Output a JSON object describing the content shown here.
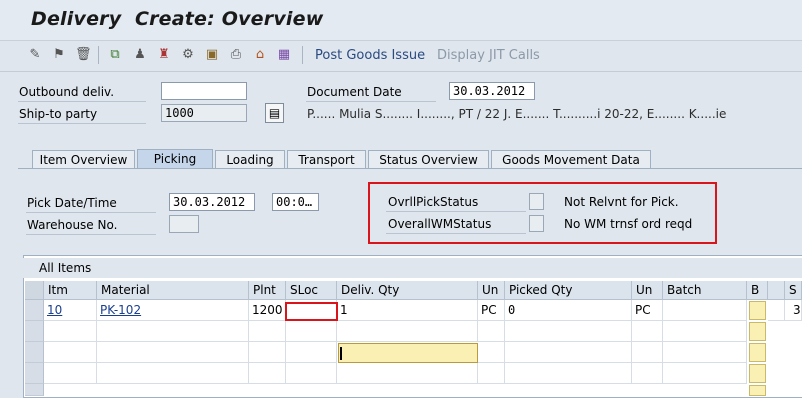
{
  "title": "Delivery  Create: Overview",
  "toolbar": {
    "icons": [
      "edit-icon",
      "flag-icon",
      "delete-icon",
      "save-local-icon",
      "person-icon",
      "partner-icon",
      "tools-icon",
      "package-icon",
      "print-icon",
      "home-icon",
      "grid-icon"
    ],
    "post_goods_issue": "Post Goods Issue",
    "display_jit_calls": "Display JIT Calls"
  },
  "header": {
    "outbound_deliv_label": "Outbound deliv.",
    "outbound_deliv_value": "",
    "ship_to_label": "Ship-to party",
    "ship_to_value": "1000",
    "document_date_label": "Document Date",
    "document_date_value": "30.03.2012",
    "address_text": "P...... Mulia S........ I........, PT / 22 J. E....... T..........i 20-22, E........ K.....ie"
  },
  "tabs": [
    "Item Overview",
    "Picking",
    "Loading",
    "Transport",
    "Status Overview",
    "Goods Movement Data"
  ],
  "active_tab": "Picking",
  "picking": {
    "pick_date_label": "Pick Date/Time",
    "pick_date_value": "30.03.2012",
    "pick_time_value": "00:0…",
    "warehouse_label": "Warehouse No.",
    "warehouse_value": "",
    "ovrll_pick_label": "OvrllPickStatus",
    "ovrll_pick_text": "Not Relvnt for Pick.",
    "overall_wm_label": "OverallWMStatus",
    "overall_wm_text": "No WM trnsf ord reqd"
  },
  "table": {
    "title": "All Items",
    "columns": [
      "Itm",
      "Material",
      "Plnt",
      "SLoc",
      "Deliv. Qty",
      "Un",
      "Picked Qty",
      "Un",
      "Batch",
      "B",
      "S"
    ],
    "rows": [
      {
        "itm": "10",
        "material": "PK-102",
        "plnt": "1200",
        "sloc": "",
        "deliv_qty": "1",
        "un": "PC",
        "picked_qty": "0",
        "un2": "PC",
        "batch": "",
        "b": "",
        "s": "3"
      }
    ]
  },
  "colors": {
    "highlight_red": "#d9141b",
    "field_yellow": "#fbf0b4",
    "link_blue": "#1b3f8f"
  }
}
